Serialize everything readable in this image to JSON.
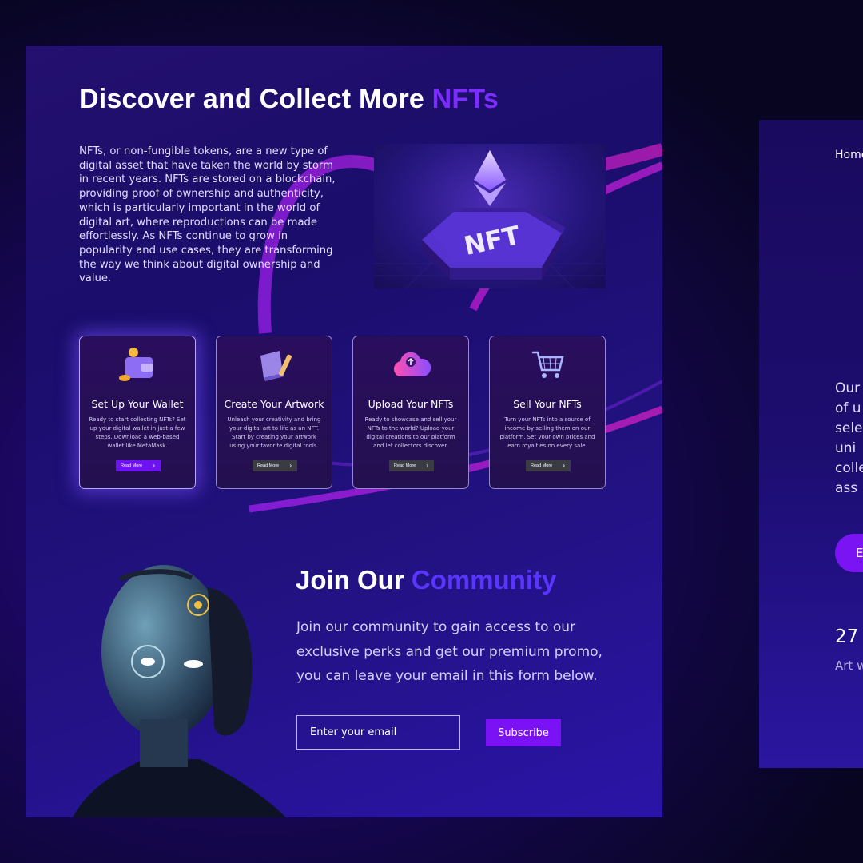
{
  "main": {
    "title_prefix": "Discover and Collect More",
    "title_accent": "NFTs",
    "intro": "NFTs, or non-fungible tokens, are a new type of digital asset that have taken the world by storm in recent years. NFTs are stored on a blockchain, providing proof of ownership and authenticity, which is particularly important in the world of digital art, where reproductions can be made effortlessly. As NFTs continue to grow in popularity and use cases, they are transforming the way we think about digital ownership and value.",
    "hero_label": "NFT",
    "cards": [
      {
        "title": "Set Up Your Wallet",
        "desc": "Ready to start collecting NFTs? Set up your digital wallet in just a few steps. Download a web-based wallet like MetaMask.",
        "button": "Read More",
        "icon": "wallet-icon"
      },
      {
        "title": "Create Your Artwork",
        "desc": "Unleash your creativity and bring your digital art to life as an NFT. Start by creating your artwork using your favorite digital tools.",
        "button": "Read More",
        "icon": "book-pencil-icon"
      },
      {
        "title": "Upload Your NFTs",
        "desc": "Ready to showcase and sell your NFTs to the world? Upload your digital creations to our platform and let collectors discover.",
        "button": "Read More",
        "icon": "cloud-upload-icon"
      },
      {
        "title": "Sell Your NFTs",
        "desc": "Turn your NFTs into a source of income by selling them on our platform. Set your own prices and earn royalties on every sale.",
        "button": "Read More",
        "icon": "shopping-cart-icon"
      }
    ],
    "join": {
      "title_prefix": "Join Our",
      "title_accent": "Community",
      "text": "Join our community to gain access to our exclusive perks and get our premium promo, you can leave your email in this form below.",
      "email_placeholder": "Enter your email",
      "subscribe_label": "Subscribe"
    }
  },
  "side_panel": {
    "nav_home": "Home",
    "body_lines": [
      "Our",
      "of u",
      "sele",
      "uni",
      "colle",
      "ass"
    ],
    "button_label": "E",
    "stat_value": "27",
    "stat_label": "Art w"
  },
  "colors": {
    "accent_violet": "#7c2cff",
    "accent_blue": "#5a35ff",
    "button_purple": "#7b12f5",
    "background": "#14064a"
  }
}
